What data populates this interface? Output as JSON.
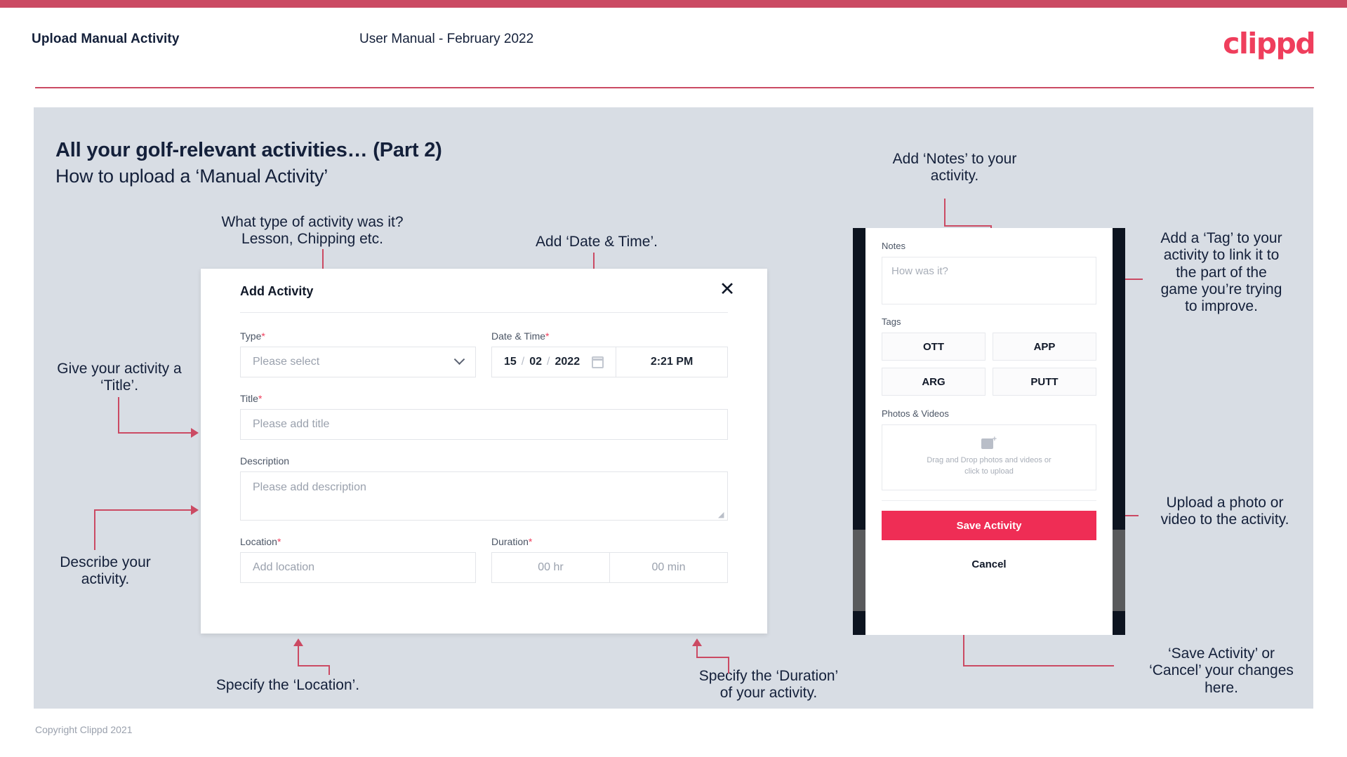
{
  "header": {
    "title": "Upload Manual Activity",
    "subtitle": "User Manual - February 2022",
    "brand": "clippd"
  },
  "slide": {
    "title": "All your golf-relevant activities… (Part 2)",
    "subtitle": "How to upload a ‘Manual Activity’"
  },
  "annotations": {
    "type": "What type of activity was it?\nLesson, Chipping etc.",
    "datetime": "Add ‘Date & Time’.",
    "title": "Give your activity a\n‘Title’.",
    "describe": "Describe your\nactivity.",
    "location": "Specify the ‘Location’.",
    "duration": "Specify the ‘Duration’\nof your activity.",
    "notes": "Add ‘Notes’ to your\nactivity.",
    "tag": "Add a ‘Tag’ to your\nactivity to link it to\nthe part of the\ngame you’re trying\nto improve.",
    "upload": "Upload a photo or\nvideo to the activity.",
    "save": "‘Save Activity’ or\n‘Cancel’ your changes\nhere."
  },
  "modal": {
    "title": "Add Activity",
    "close_label": "✕",
    "fields": {
      "type": {
        "label": "Type",
        "required": "*",
        "placeholder": "Please select"
      },
      "datetime": {
        "label": "Date & Time",
        "required": "*",
        "day": "15",
        "month": "02",
        "year": "2022",
        "sep": "/",
        "time": "2:21 PM"
      },
      "title": {
        "label": "Title",
        "required": "*",
        "placeholder": "Please add title"
      },
      "description": {
        "label": "Description",
        "required": "",
        "placeholder": "Please add description"
      },
      "location": {
        "label": "Location",
        "required": "*",
        "placeholder": "Add location"
      },
      "duration": {
        "label": "Duration",
        "required": "*",
        "hours": "00 hr",
        "minutes": "00 min"
      }
    }
  },
  "phone": {
    "notes": {
      "label": "Notes",
      "placeholder": "How was it?"
    },
    "tags": {
      "label": "Tags",
      "items": [
        "OTT",
        "APP",
        "ARG",
        "PUTT"
      ]
    },
    "photos": {
      "label": "Photos & Videos",
      "dropzone_line1": "Drag and Drop photos and videos or",
      "dropzone_line2": "click to upload"
    },
    "save_label": "Save Activity",
    "cancel_label": "Cancel"
  },
  "footer": {
    "copyright": "Copyright Clippd 2021"
  },
  "colors": {
    "accent": "#cb4a63",
    "brand": "#ef3e5c",
    "save": "#ef2d55",
    "panel_bg": "#d8dde4",
    "text_dark": "#14203a"
  }
}
